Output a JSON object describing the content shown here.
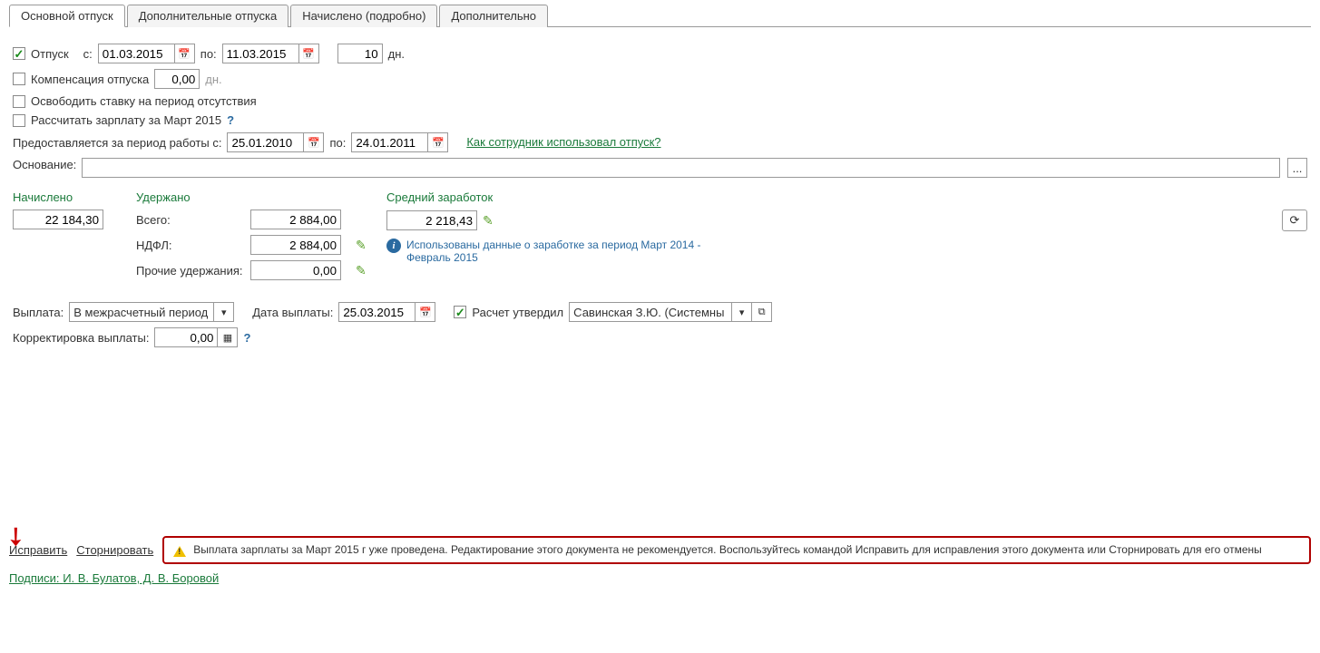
{
  "tabs": {
    "main": "Основной отпуск",
    "additional": "Дополнительные отпуска",
    "accrued": "Начислено (подробно)",
    "extra": "Дополнительно"
  },
  "vacation": {
    "label": "Отпуск",
    "from_lbl": "с:",
    "to_lbl": "по:",
    "from": "01.03.2015",
    "to": "11.03.2015",
    "days": "10",
    "days_suffix": "дн."
  },
  "compensation": {
    "label": "Компенсация отпуска",
    "value": "0,00",
    "suffix": "дн."
  },
  "release_rate_label": "Освободить ставку на период отсутствия",
  "calc_salary_label": "Рассчитать зарплату за Март 2015",
  "work_period": {
    "label": "Предоставляется за период работы с:",
    "from": "25.01.2010",
    "to_lbl": "по:",
    "to": "24.01.2011",
    "link": "Как сотрудник использовал отпуск?"
  },
  "basis": {
    "label": "Основание:",
    "ellipsis": "..."
  },
  "accrued": {
    "title": "Начислено",
    "value": "22 184,30"
  },
  "deducted": {
    "title": "Удержано",
    "total_lbl": "Всего:",
    "total": "2 884,00",
    "ndfl_lbl": "НДФЛ:",
    "ndfl": "2 884,00",
    "other_lbl": "Прочие удержания:",
    "other": "0,00"
  },
  "avg_earnings": {
    "title": "Средний заработок",
    "value": "2 218,43",
    "info": "Использованы данные о заработке за период Март 2014 - Февраль 2015"
  },
  "payment": {
    "label": "Выплата:",
    "select": "В межрасчетный период",
    "date_lbl": "Дата выплаты:",
    "date": "25.03.2015",
    "approved_lbl": "Расчет утвердил",
    "approver": "Савинская З.Ю. (Системны"
  },
  "correction": {
    "label": "Корректировка выплаты:",
    "value": "0,00"
  },
  "footer": {
    "correct": "Исправить",
    "reverse": "Сторнировать",
    "warning": "Выплата зарплаты за Март 2015 г уже проведена. Редактирование этого документа не рекомендуется. Воспользуйтесь командой Исправить для исправления этого документа или Сторнировать для его отмены",
    "signatures_lbl": "Подписи:",
    "signatures": "И. В. Булатов, Д. В. Боровой"
  },
  "icons": {
    "calendar": "📅",
    "dropdown": "▾",
    "popup": "⧉",
    "refresh": "⟳",
    "pencil": "✎",
    "table": "▦"
  }
}
